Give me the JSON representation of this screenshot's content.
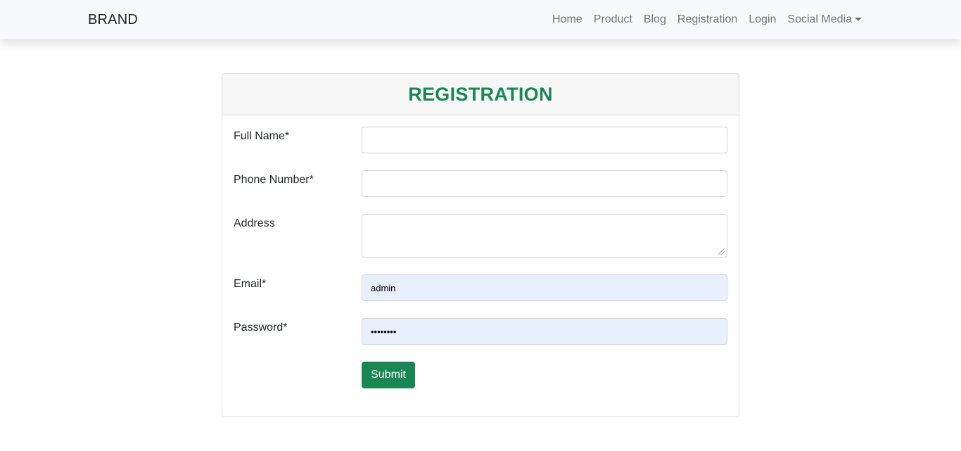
{
  "navbar": {
    "brand": "BRAND",
    "links": [
      "Home",
      "Product",
      "Blog",
      "Registration",
      "Login"
    ],
    "dropdown_label": "Social Media"
  },
  "form": {
    "title": "REGISTRATION",
    "full_name": {
      "label": "Full Name*",
      "value": ""
    },
    "phone": {
      "label": "Phone Number*",
      "value": ""
    },
    "address": {
      "label": "Address",
      "value": ""
    },
    "email": {
      "label": "Email*",
      "value": "admin"
    },
    "password": {
      "label": "Password*",
      "value": "••••••••"
    },
    "submit_label": "Submit"
  },
  "colors": {
    "accent": "#198754",
    "autofill_bg": "#e8f0fe",
    "navbar_bg": "#f8f9fa"
  }
}
